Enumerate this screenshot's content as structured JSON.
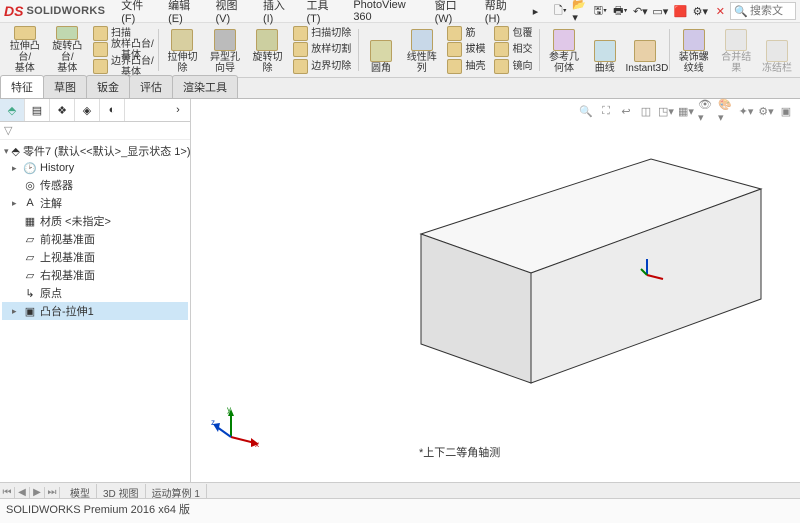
{
  "app": {
    "logo_ds": "DS",
    "logo_name": "SOLIDWORKS",
    "search_placeholder": "搜索文"
  },
  "menu": {
    "file": "文件(F)",
    "edit": "编辑(E)",
    "view": "视图(V)",
    "insert": "插入(I)",
    "tools": "工具(T)",
    "photoview": "PhotoView 360",
    "window": "窗口(W)",
    "help": "帮助(H)",
    "arrow": "▸"
  },
  "qtb": {
    "new": "□",
    "open": "⎙",
    "save": "▤",
    "print": "⎙",
    "opts": "⚙",
    "sel": "▭",
    "rebuild": "⟳",
    "more": "⋯"
  },
  "ribbon": {
    "extrude": "拉伸凸\n台/基体",
    "revolve": "旋转凸\n台/基体",
    "sweep": "扫描",
    "loft": "放样凸台/基体",
    "boundary": "边界凸台/基体",
    "extrude_cut": "拉伸切\n除",
    "hole": "异型孔\n向导",
    "revolve_cut": "旋转切\n除",
    "sweep_cut": "扫描切除",
    "loft_cut": "放样切割",
    "boundary_cut": "边界切除",
    "fillet": "圆角",
    "linear": "线性阵\n列",
    "rib": "筋",
    "draft": "拔模",
    "shell": "抽壳",
    "wrap": "包覆",
    "intersect": "相交",
    "mirror": "镜向",
    "ref_geom": "参考几\n何体",
    "curves": "曲线",
    "instant3d": "Instant3D",
    "decals": "装饰螺\n纹线",
    "merge": "合并结\n果",
    "freeze": "冻结栏"
  },
  "tabs": {
    "feature": "特征",
    "sketch": "草图",
    "sheetmetal": "钣金",
    "evaluate": "评估",
    "render": "渲染工具"
  },
  "tree": {
    "root": "零件7 (默认<<默认>_显示状态 1>)",
    "history": "History",
    "sensors": "传感器",
    "annotations": "注解",
    "material": "材质 <未指定>",
    "front": "前视基准面",
    "top": "上视基准面",
    "right": "右视基准面",
    "origin": "原点",
    "feature1": "凸台-拉伸1"
  },
  "view_annotation": "*上下二等角轴测",
  "bottom_tabs": {
    "model": "模型",
    "view3d": "3D 视图",
    "motion": "运动算例 1"
  },
  "status_text": "SOLIDWORKS Premium 2016 x64 版"
}
